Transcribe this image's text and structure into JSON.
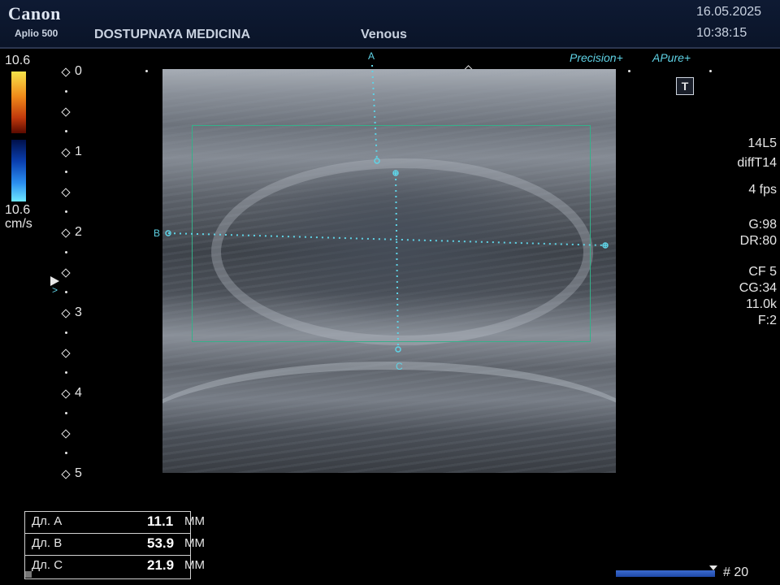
{
  "header": {
    "brand": "Canon",
    "model": "Aplio 500",
    "institution": "DOSTUPNAYA MEDICINA",
    "preset": "Venous",
    "date": "16.05.2025",
    "time": "10:38:15"
  },
  "color_scale": {
    "max": "10.6",
    "min": "10.6",
    "unit": "cm/s"
  },
  "depth_scale": [
    "0",
    "1",
    "2",
    "3",
    "4",
    "5"
  ],
  "calipers": {
    "a": "A",
    "b": "B",
    "c": "C"
  },
  "badges": {
    "precision": "Precision+",
    "apure": "APure+",
    "t_button": "T"
  },
  "parameters": {
    "probe": "14L5",
    "mode": "diffT14",
    "fps": "4 fps",
    "gain": "G:98",
    "dynamic_range": "DR:80",
    "color_frequency": "CF 5",
    "color_gain": "CG:34",
    "prf": "11.0k",
    "filter": "F:2"
  },
  "measurements": [
    {
      "label": "Дл. А",
      "value": "11.1",
      "unit": "MM"
    },
    {
      "label": "Дл. В",
      "value": "53.9",
      "unit": "MM"
    },
    {
      "label": "Дл. С",
      "value": "21.9",
      "unit": "MM"
    }
  ],
  "cine": {
    "frame": "# 20"
  },
  "colors": {
    "accent": "#5fd3e6",
    "roi_box": "#35b08a",
    "header_bg": "#0e1a33"
  }
}
